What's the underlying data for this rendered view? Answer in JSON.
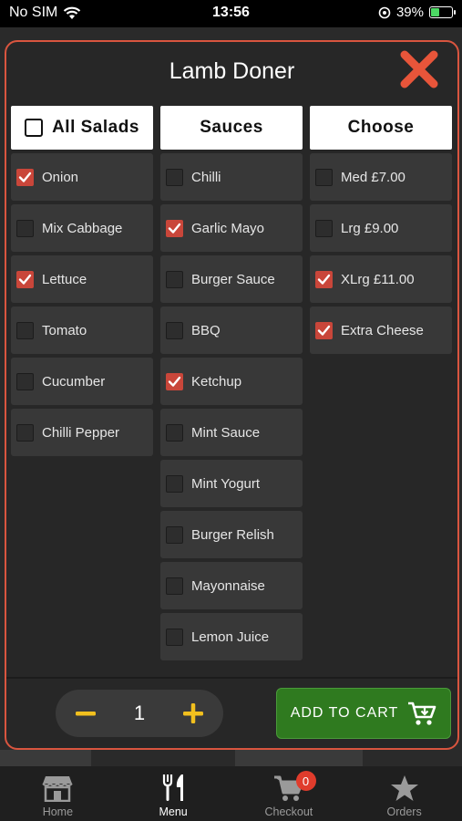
{
  "status_bar": {
    "carrier": "No SIM",
    "time": "13:56",
    "battery": "39%",
    "battery_level": 0.39
  },
  "modal": {
    "title": "Lamb Doner",
    "columns": [
      {
        "header": "All Salads",
        "options": [
          {
            "label": "Onion",
            "checked": true
          },
          {
            "label": "Mix Cabbage",
            "checked": false
          },
          {
            "label": "Lettuce",
            "checked": true
          },
          {
            "label": "Tomato",
            "checked": false
          },
          {
            "label": "Cucumber",
            "checked": false
          },
          {
            "label": "Chilli Pepper",
            "checked": false
          }
        ]
      },
      {
        "header": "Sauces",
        "options": [
          {
            "label": "Chilli",
            "checked": false
          },
          {
            "label": "Garlic Mayo",
            "checked": true
          },
          {
            "label": "Burger Sauce",
            "checked": false
          },
          {
            "label": "BBQ",
            "checked": false
          },
          {
            "label": "Ketchup",
            "checked": true
          },
          {
            "label": "Mint Sauce",
            "checked": false
          },
          {
            "label": "Mint Yogurt",
            "checked": false
          },
          {
            "label": "Burger Relish",
            "checked": false
          },
          {
            "label": "Mayonnaise",
            "checked": false
          },
          {
            "label": "Lemon Juice",
            "checked": false
          }
        ]
      },
      {
        "header": "Choose",
        "options": [
          {
            "label": "Med £7.00",
            "checked": false
          },
          {
            "label": "Lrg £9.00",
            "checked": false
          },
          {
            "label": "XLrg £11.00",
            "checked": true
          },
          {
            "label": "Extra Cheese",
            "checked": true
          }
        ]
      }
    ],
    "quantity": "1",
    "add_to_cart": "ADD TO CART"
  },
  "tabs": [
    {
      "label": "Home",
      "icon": "store-icon"
    },
    {
      "label": "Menu",
      "icon": "fork-knife-icon"
    },
    {
      "label": "Checkout",
      "icon": "cart-icon",
      "badge": "0"
    },
    {
      "label": "Orders",
      "icon": "star-icon"
    }
  ],
  "colors": {
    "accent": "#d9553f",
    "checkbox": "#c9463a",
    "cart_button": "#2f7a1f",
    "stepper_icon": "#f2c01e"
  }
}
